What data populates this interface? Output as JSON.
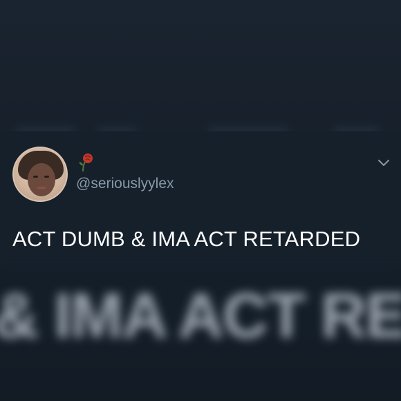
{
  "tweet": {
    "handle": "@seriouslyylex",
    "text": "ACT DUMB & IMA ACT RETARDED",
    "name_emoji": "rose-emoji",
    "menu_icon": "chevron-down-icon"
  },
  "overlay": {
    "blurred_echo_text": "& IMA ACT RE"
  },
  "colors": {
    "background": "#15202b",
    "text_primary": "#ffffff",
    "text_secondary": "#8899a6"
  }
}
